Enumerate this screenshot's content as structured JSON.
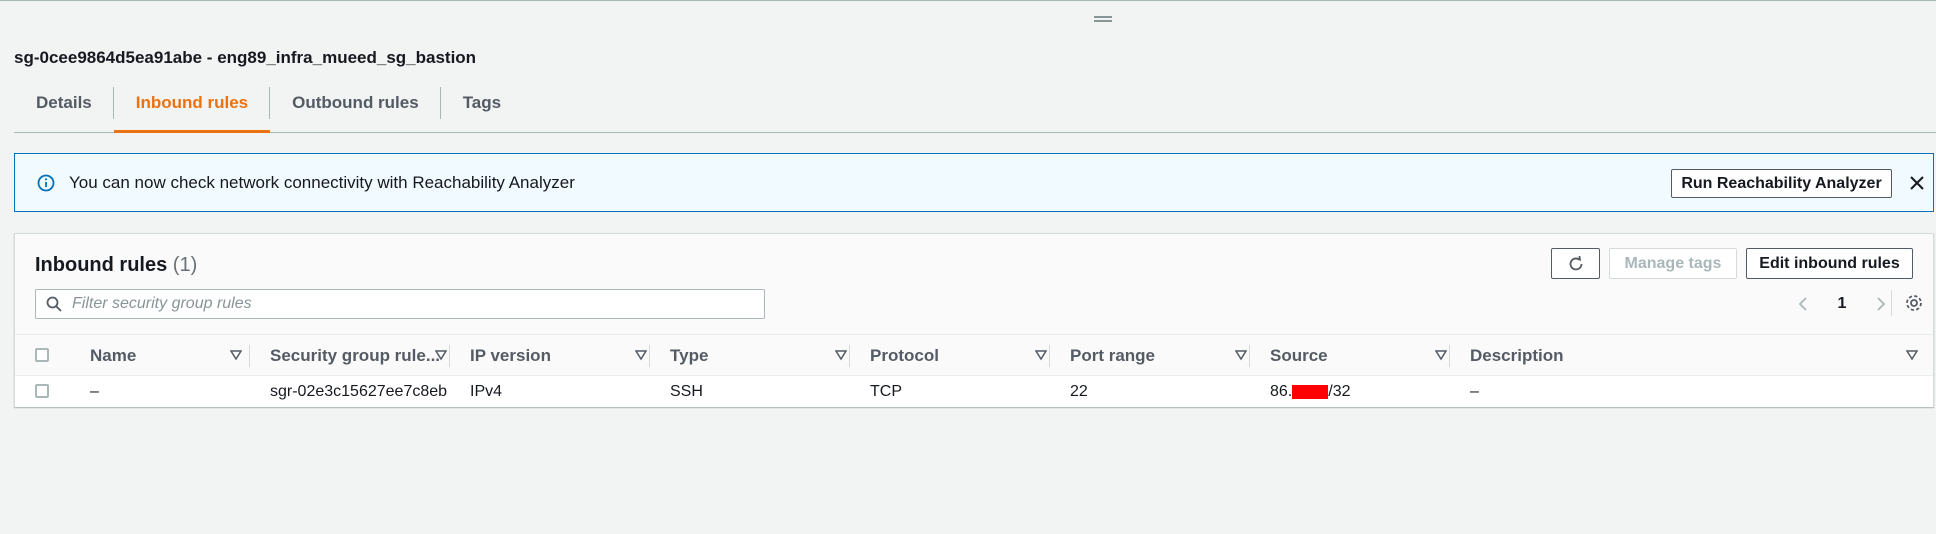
{
  "security_group": {
    "title": "sg-0cee9864d5ea91abe - eng89_infra_mueed_sg_bastion"
  },
  "tabs": [
    {
      "label": "Details",
      "active": false
    },
    {
      "label": "Inbound rules",
      "active": true
    },
    {
      "label": "Outbound rules",
      "active": false
    },
    {
      "label": "Tags",
      "active": false
    }
  ],
  "banner": {
    "message": "You can now check network connectivity with Reachability Analyzer",
    "button_label": "Run Reachability Analyzer",
    "icon": "info-icon"
  },
  "panel": {
    "title": "Inbound rules",
    "count": "(1)",
    "manage_tags_label": "Manage tags",
    "edit_label": "Edit inbound rules",
    "filter_placeholder": "Filter security group rules",
    "page": "1"
  },
  "table": {
    "headers": [
      "Name",
      "Security group rule...",
      "IP version",
      "Type",
      "Protocol",
      "Port range",
      "Source",
      "Description"
    ],
    "rows": [
      {
        "name": "–",
        "rule_id": "sgr-02e3c15627ee7c8eb",
        "ip_version": "IPv4",
        "type": "SSH",
        "protocol": "TCP",
        "port_range": "22",
        "source_prefix": "86.",
        "source_suffix": "/32",
        "description": "–"
      }
    ]
  },
  "colors": {
    "accent": "#ec7211",
    "info_border": "#0073bb",
    "info_bg": "#f1faff",
    "redaction": "#ff0000"
  }
}
